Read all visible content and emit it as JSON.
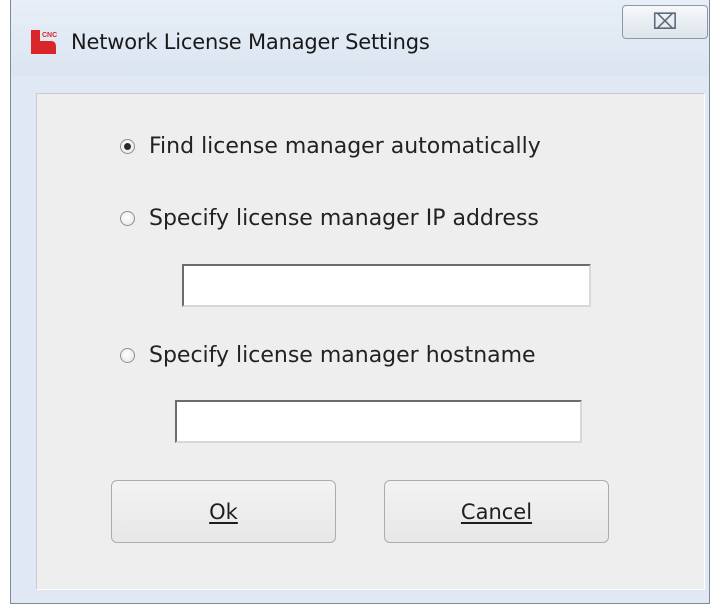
{
  "window": {
    "title": "Network License Manager Settings",
    "icon": "cnc-app-icon",
    "close_glyph": "⌧"
  },
  "options": [
    {
      "label": "Find license manager automatically",
      "checked": true
    },
    {
      "label": "Specify license manager IP address",
      "checked": false
    },
    {
      "label": "Specify license manager hostname",
      "checked": false
    }
  ],
  "fields": {
    "ip_address": {
      "value": "",
      "placeholder": ""
    },
    "hostname": {
      "value": "",
      "placeholder": ""
    }
  },
  "buttons": {
    "ok": "Ok",
    "cancel": "Cancel"
  },
  "colors": {
    "titlebar": "#dfe8f3",
    "client_bg": "#eeeeee",
    "icon_red": "#d8262b"
  }
}
